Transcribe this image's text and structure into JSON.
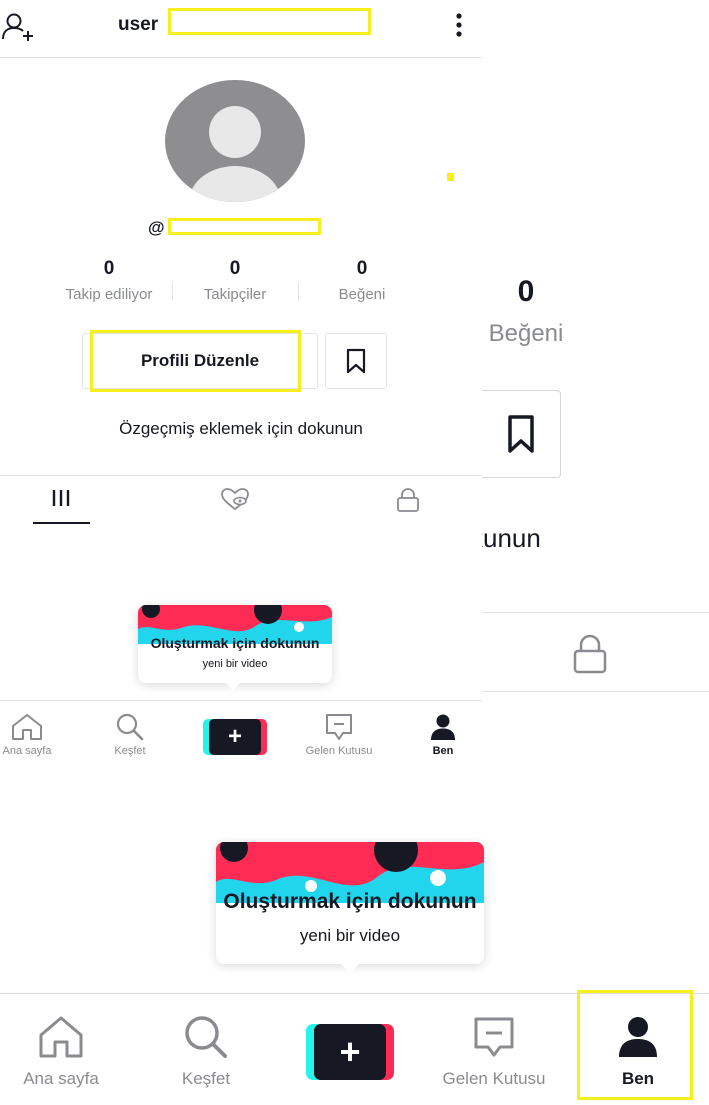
{
  "header": {
    "username": "user",
    "handle_prefix": "@"
  },
  "stats": [
    {
      "value": "0",
      "label": "Takip ediliyor"
    },
    {
      "value": "0",
      "label": "Takipçiler"
    },
    {
      "value": "0",
      "label": "Beğeni"
    }
  ],
  "profile": {
    "edit_label": "Profili Düzenle",
    "bio_prompt": "Özgeçmiş eklemek için dokunun"
  },
  "tabs": [
    {
      "icon": "videos-grid-icon"
    },
    {
      "icon": "liked-videos-icon"
    },
    {
      "icon": "private-lock-icon"
    }
  ],
  "tooltip": {
    "title": "Oluşturmak için dokunun",
    "subtitle": "yeni bir video"
  },
  "nav": {
    "items": [
      {
        "label": "Ana sayfa",
        "icon": "home-icon"
      },
      {
        "label": "Keşfet",
        "icon": "search-icon"
      },
      {
        "label": "+",
        "icon": "create-plus-icon"
      },
      {
        "label": "Gelen Kutusu",
        "icon": "inbox-icon"
      },
      {
        "label": "Ben",
        "icon": "profile-icon",
        "active": true
      }
    ]
  },
  "background_zoom": {
    "stat_value": "0",
    "stat_label": "Beğeni",
    "bio_fragment": "kunun"
  },
  "colors": {
    "highlight": "#f7ef1c",
    "text": "#161823",
    "muted": "#8a8b91",
    "cyan": "#25f4ee",
    "pink": "#fe2c55"
  }
}
